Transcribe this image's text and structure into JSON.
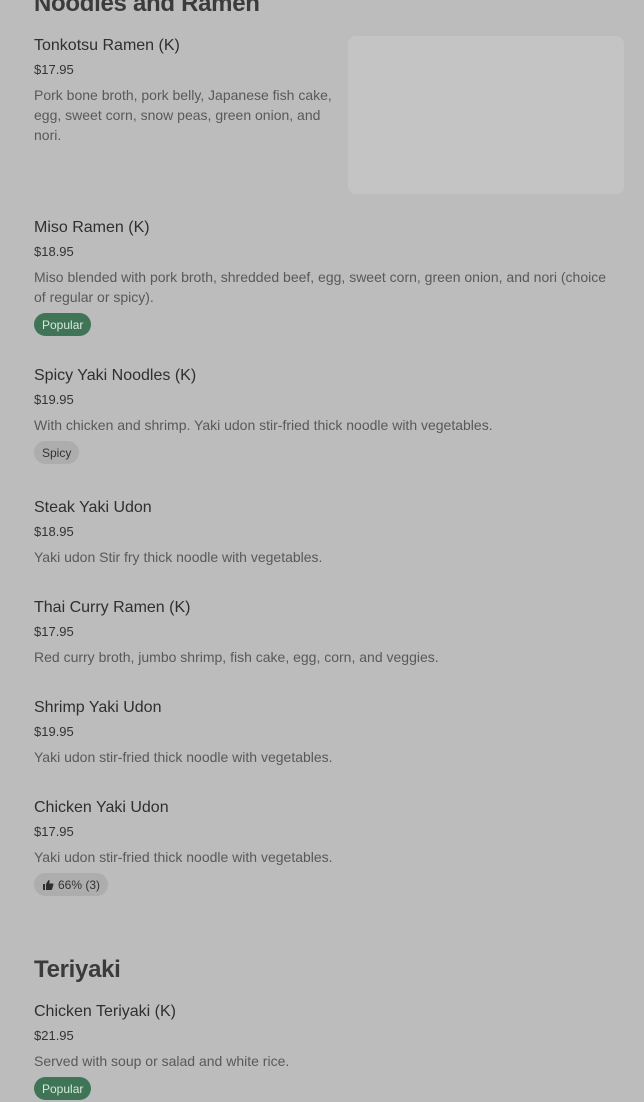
{
  "sections": [
    {
      "title": "Noodles and Ramen",
      "items": [
        {
          "name": "Tonkotsu Ramen (K)",
          "price": "$17.95",
          "description": "Pork bone broth, pork belly, Japanese fish cake, egg, sweet corn, snow peas, green onion, and nori."
        },
        {
          "name": "Miso Ramen (K)",
          "price": "$18.95",
          "description": "Miso blended with pork broth, shredded beef, egg, sweet corn, green onion, and nori (choice of regular or spicy).",
          "badge": "Popular"
        },
        {
          "name": "Spicy Yaki Noodles (K)",
          "price": "$19.95",
          "description": "With chicken and shrimp. Yaki udon stir-fried thick noodle with vegetables.",
          "badge": "Spicy"
        },
        {
          "name": "Steak Yaki Udon",
          "price": "$18.95",
          "description": "Yaki udon Stir fry thick noodle with vegetables."
        },
        {
          "name": "Thai Curry Ramen (K)",
          "price": "$17.95",
          "description": "Red curry broth, jumbo shrimp, fish cake, egg, corn, and veggies."
        },
        {
          "name": "Shrimp Yaki Udon",
          "price": "$19.95",
          "description": "Yaki udon stir-fried thick noodle with vegetables."
        },
        {
          "name": "Chicken Yaki Udon",
          "price": "$17.95",
          "description": "Yaki udon stir-fried thick noodle with vegetables.",
          "rating": "66% (3)",
          "rating_icon": "thumbs-up-icon"
        }
      ]
    },
    {
      "title": "Teriyaki",
      "items": [
        {
          "name": "Chicken Teriyaki (K)",
          "price": "$21.95",
          "description": "Served with soup or salad and white rice.",
          "badge": "Popular"
        }
      ]
    }
  ],
  "colors": {
    "background": "#bcbcbc",
    "popular_badge": "#3f7556",
    "neutral_badge": "#adadad"
  }
}
